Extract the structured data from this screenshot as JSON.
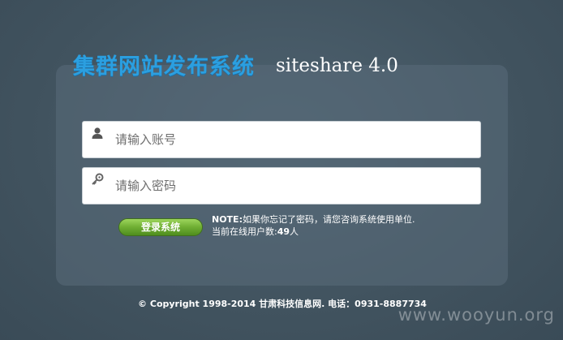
{
  "brand": {
    "title_cn": "集群网站发布系统",
    "title_en": "siteshare  4.0"
  },
  "login": {
    "username_placeholder": "请输入账号",
    "username_icon": "user-icon",
    "password_placeholder": "请输入密码",
    "password_icon": "key-icon",
    "submit_label": "登录系统"
  },
  "note": {
    "label": "NOTE:",
    "text": "如果你忘记了密码，请您咨询系统使用单位.",
    "online_label": "当前在线用户数:",
    "online_count": "49",
    "online_unit": "人"
  },
  "footer": {
    "copyright": "© Copyright 1998-2014 甘肃科技信息网. 电话：0931-8887734"
  },
  "watermark": "www.wooyun.org",
  "colors": {
    "brand_blue": "#2b9fe0",
    "button_green": "#6fae33",
    "background": "#41535f"
  }
}
